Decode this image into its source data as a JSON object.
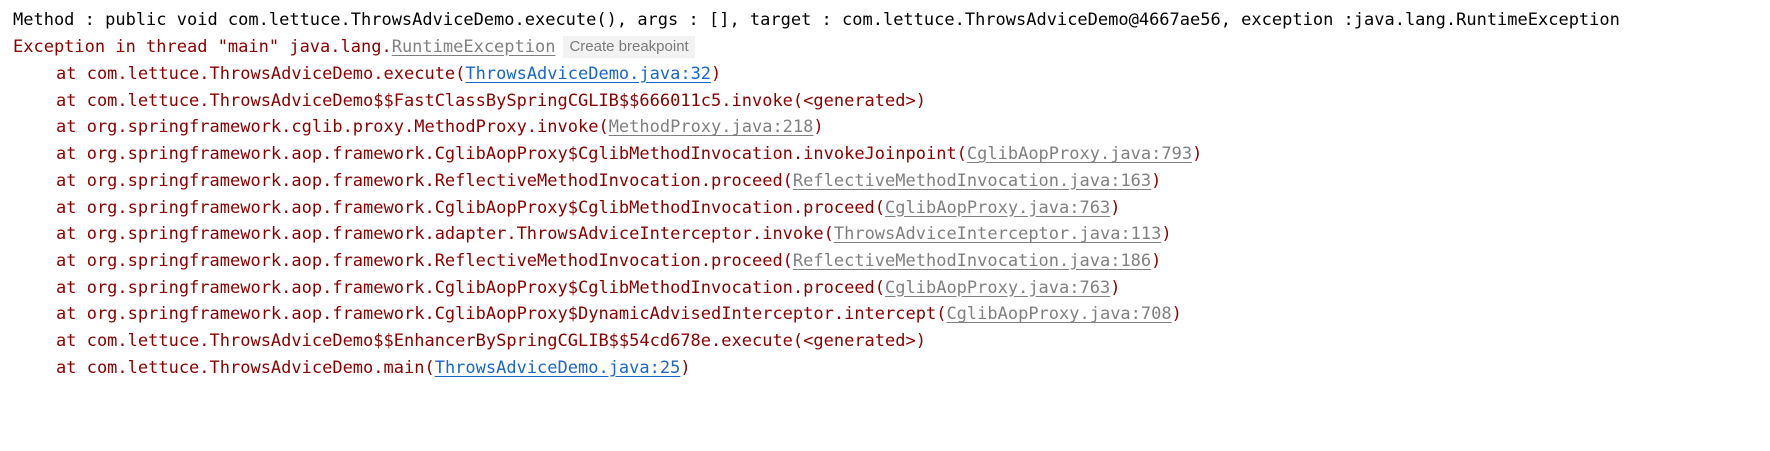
{
  "console": {
    "stdout_line": "Method : public void com.lettuce.ThrowsAdviceDemo.execute(), args : [], target : com.lettuce.ThrowsAdviceDemo@4667ae56, exception :java.lang.RuntimeException",
    "exception_header": {
      "prefix": "Exception in thread \"main\" java.lang.",
      "class_link": "RuntimeException",
      "hint": "Create breakpoint"
    },
    "frames": [
      {
        "prefix": "at com.lettuce.ThrowsAdviceDemo.execute(",
        "link": "ThrowsAdviceDemo.java:32",
        "suffix": ")"
      },
      {
        "prefix": "at com.lettuce.ThrowsAdviceDemo$$FastClassBySpringCGLIB$$666011c5.invoke(<generated>)",
        "link": "",
        "suffix": ""
      },
      {
        "prefix": "at org.springframework.cglib.proxy.MethodProxy.invoke(",
        "link": "MethodProxy.java:218",
        "suffix": ")"
      },
      {
        "prefix": "at org.springframework.aop.framework.CglibAopProxy$CglibMethodInvocation.invokeJoinpoint(",
        "link": "CglibAopProxy.java:793",
        "suffix": ")"
      },
      {
        "prefix": "at org.springframework.aop.framework.ReflectiveMethodInvocation.proceed(",
        "link": "ReflectiveMethodInvocation.java:163",
        "suffix": ")"
      },
      {
        "prefix": "at org.springframework.aop.framework.CglibAopProxy$CglibMethodInvocation.proceed(",
        "link": "CglibAopProxy.java:763",
        "suffix": ")"
      },
      {
        "prefix": "at org.springframework.aop.framework.adapter.ThrowsAdviceInterceptor.invoke(",
        "link": "ThrowsAdviceInterceptor.java:113",
        "suffix": ")"
      },
      {
        "prefix": "at org.springframework.aop.framework.ReflectiveMethodInvocation.proceed(",
        "link": "ReflectiveMethodInvocation.java:186",
        "suffix": ")"
      },
      {
        "prefix": "at org.springframework.aop.framework.CglibAopProxy$CglibMethodInvocation.proceed(",
        "link": "CglibAopProxy.java:763",
        "suffix": ")"
      },
      {
        "prefix": "at org.springframework.aop.framework.CglibAopProxy$DynamicAdvisedInterceptor.intercept(",
        "link": "CglibAopProxy.java:708",
        "suffix": ")"
      },
      {
        "prefix": "at com.lettuce.ThrowsAdviceDemo$$EnhancerBySpringCGLIB$$54cd678e.execute(<generated>)",
        "link": "",
        "suffix": ""
      },
      {
        "prefix": "at com.lettuce.ThrowsAdviceDemo.main(",
        "link": "ThrowsAdviceDemo.java:25",
        "suffix": ")"
      }
    ]
  },
  "colors": {
    "stderr": "#8a0000",
    "stdout": "#000000",
    "local_link": "#1a66c9",
    "library_link": "#808080"
  }
}
